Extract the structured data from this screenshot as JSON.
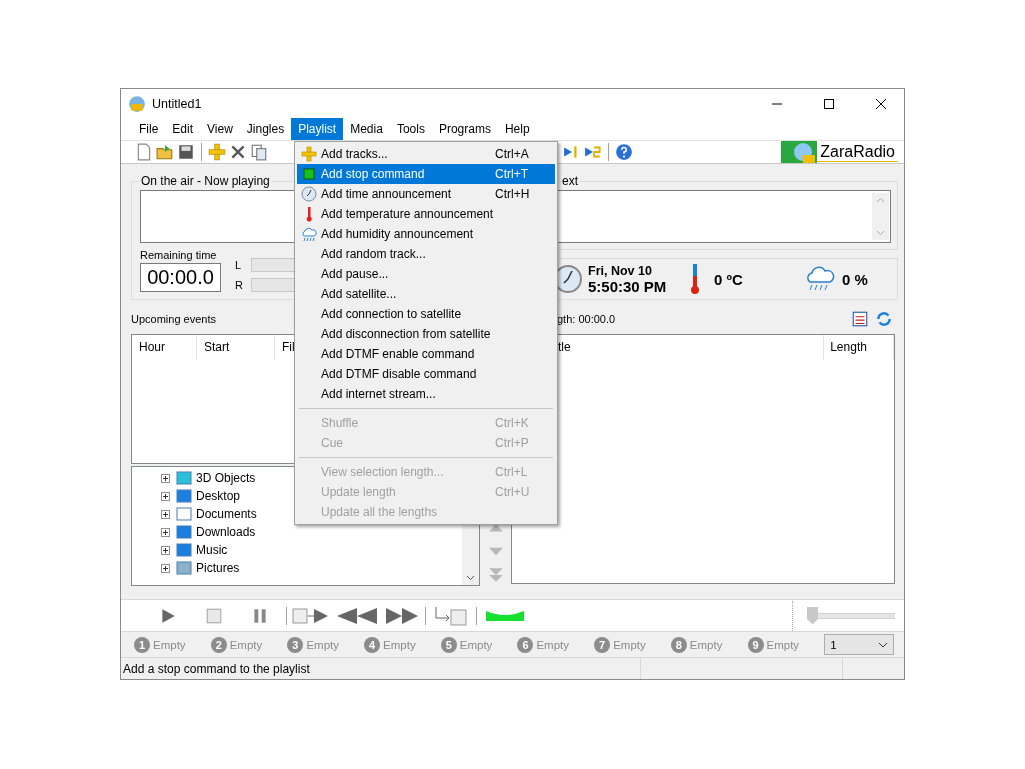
{
  "window": {
    "title": "Untitled1"
  },
  "menubar": [
    {
      "label": "File",
      "selected": false
    },
    {
      "label": "Edit",
      "selected": false
    },
    {
      "label": "View",
      "selected": false
    },
    {
      "label": "Jingles",
      "selected": false
    },
    {
      "label": "Playlist",
      "selected": true
    },
    {
      "label": "Media",
      "selected": false
    },
    {
      "label": "Tools",
      "selected": false
    },
    {
      "label": "Programs",
      "selected": false
    },
    {
      "label": "Help",
      "selected": false
    }
  ],
  "logo": {
    "label": "ZaraRadio"
  },
  "menu": {
    "items": [
      {
        "kind": "item",
        "label": "Add tracks...",
        "shortcut": "Ctrl+A",
        "selected": false,
        "disabled": false
      },
      {
        "kind": "item",
        "label": "Add stop command",
        "shortcut": "Ctrl+T",
        "selected": true,
        "disabled": false
      },
      {
        "kind": "item",
        "label": "Add time announcement",
        "shortcut": "Ctrl+H",
        "selected": false,
        "disabled": false
      },
      {
        "kind": "item",
        "label": "Add temperature announcement",
        "selected": false,
        "disabled": false
      },
      {
        "kind": "item",
        "label": "Add humidity announcement",
        "selected": false,
        "disabled": false
      },
      {
        "kind": "item",
        "label": "Add random track...",
        "selected": false,
        "disabled": false
      },
      {
        "kind": "item",
        "label": "Add pause...",
        "selected": false,
        "disabled": false
      },
      {
        "kind": "item",
        "label": "Add satellite...",
        "selected": false,
        "disabled": false
      },
      {
        "kind": "item",
        "label": "Add connection to satellite",
        "selected": false,
        "disabled": false
      },
      {
        "kind": "item",
        "label": "Add disconnection from satellite",
        "selected": false,
        "disabled": false
      },
      {
        "kind": "item",
        "label": "Add DTMF enable command",
        "selected": false,
        "disabled": false
      },
      {
        "kind": "item",
        "label": "Add DTMF disable command",
        "selected": false,
        "disabled": false
      },
      {
        "kind": "item",
        "label": "Add internet stream...",
        "selected": false,
        "disabled": false
      },
      {
        "kind": "separator"
      },
      {
        "kind": "item",
        "label": "Shuffle",
        "shortcut": "Ctrl+K",
        "selected": false,
        "disabled": true
      },
      {
        "kind": "item",
        "label": "Cue",
        "shortcut": "Ctrl+P",
        "selected": false,
        "disabled": true
      },
      {
        "kind": "separator"
      },
      {
        "kind": "item",
        "label": "View selection length...",
        "shortcut": "Ctrl+L",
        "selected": false,
        "disabled": true
      },
      {
        "kind": "item",
        "label": "Update length",
        "shortcut": "Ctrl+U",
        "selected": false,
        "disabled": true
      },
      {
        "kind": "item",
        "label": "Update all the lengths",
        "selected": false,
        "disabled": true
      }
    ]
  },
  "now_playing": {
    "title": "On the air - Now playing",
    "remaining_label": "Remaining time",
    "remaining": "00:00.0",
    "channels": [
      "L",
      "R"
    ]
  },
  "next": {
    "title": "ext"
  },
  "info": {
    "date": "Fri, Nov 10",
    "time": "5:50:30 PM",
    "temperature": "0 ºC",
    "humidity": "0 %"
  },
  "upcoming": {
    "title": "Upcoming events",
    "columns": [
      "Hour",
      "Start",
      "Fil"
    ]
  },
  "playlist": {
    "length": "gth: 00:00.0",
    "columns": [
      "tle",
      "Length"
    ]
  },
  "tree": {
    "items": [
      {
        "label": "3D Objects",
        "expanded": false
      },
      {
        "label": "Desktop",
        "expanded": false
      },
      {
        "label": "Documents",
        "expanded": false
      },
      {
        "label": "Downloads",
        "expanded": false
      },
      {
        "label": "Music",
        "expanded": false
      },
      {
        "label": "Pictures",
        "expanded": false
      }
    ]
  },
  "volume": {
    "level": 0
  },
  "jingles": [
    {
      "number": "1",
      "label": "Empty"
    },
    {
      "number": "2",
      "label": "Empty"
    },
    {
      "number": "3",
      "label": "Empty"
    },
    {
      "number": "4",
      "label": "Empty"
    },
    {
      "number": "5",
      "label": "Empty"
    },
    {
      "number": "6",
      "label": "Empty"
    },
    {
      "number": "7",
      "label": "Empty"
    },
    {
      "number": "8",
      "label": "Empty"
    },
    {
      "number": "9",
      "label": "Empty"
    }
  ],
  "jingle_set": {
    "value": "1"
  },
  "status_bar": {
    "text": "Add a stop command to the playlist"
  }
}
